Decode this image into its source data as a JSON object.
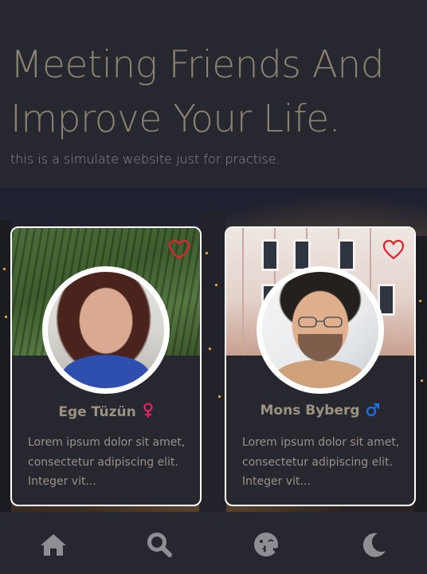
{
  "hero": {
    "title": "Meeting Friends And\nImprove Your Life.",
    "subtitle": "this is a simulate website just for practise."
  },
  "profiles": [
    {
      "name": "Ege Tüzün",
      "gender": "female",
      "gender_symbol": "♀",
      "gender_color": "#e0245e",
      "bio": "Lorem ipsum dolor sit amet, consectetur adipiscing elit. Integer vit...",
      "favorite_icon": "heart-outline-icon"
    },
    {
      "name": "Mons Byberg",
      "gender": "male",
      "gender_symbol": "♂",
      "gender_color": "#1a73e8",
      "bio": "Lorem ipsum dolor sit amet, consectetur adipiscing elit. Integer vit...",
      "favorite_icon": "heart-outline-icon"
    }
  ],
  "navbar": {
    "items": [
      {
        "icon": "home-icon"
      },
      {
        "icon": "search-icon"
      },
      {
        "icon": "kiss-emoji-icon"
      },
      {
        "icon": "moon-icon"
      }
    ]
  },
  "colors": {
    "background": "#272730",
    "title_text": "#8a8270",
    "card_border": "#ffffff",
    "heart": "#e0242f",
    "nav_icon": "#8e8e95"
  }
}
